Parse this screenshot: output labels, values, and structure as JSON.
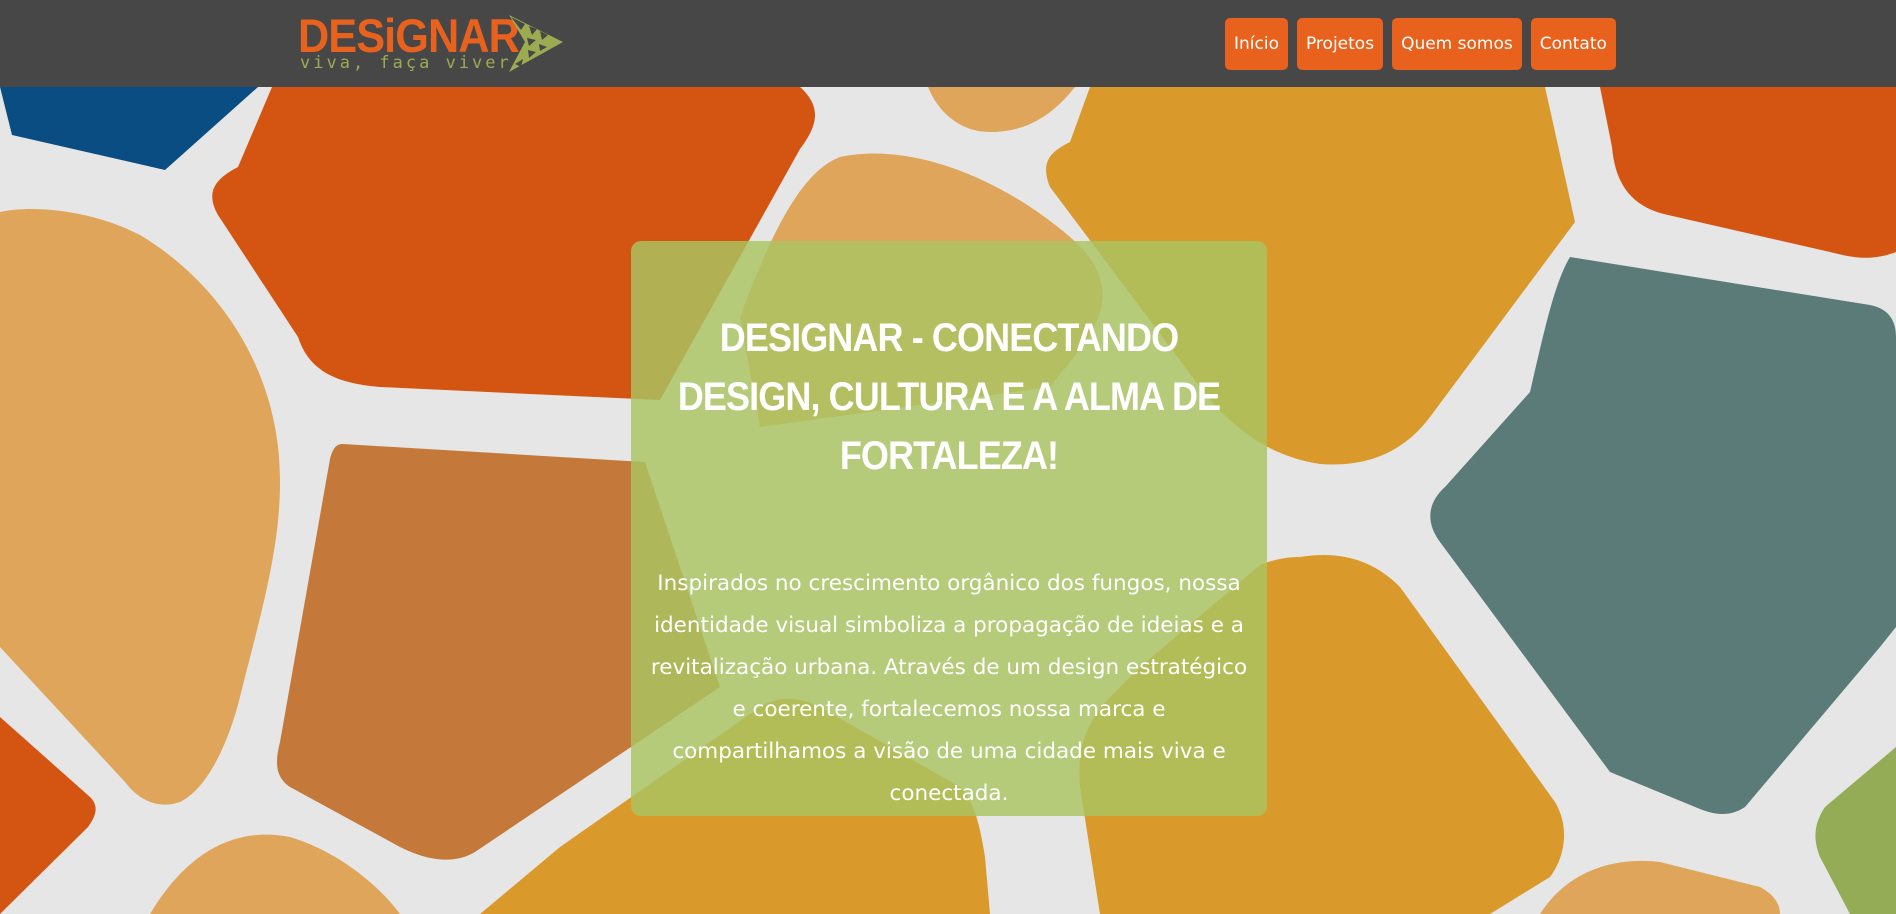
{
  "header": {
    "logo": {
      "word": "DESiGNAR",
      "tagline": "viva, faça viver",
      "icon": "arrow-mosaic-icon"
    },
    "nav": [
      {
        "label": "Início",
        "icon": null
      },
      {
        "label": "Projetos",
        "icon": null
      },
      {
        "label": "Quem somos",
        "icon": null
      },
      {
        "label": "Contato",
        "icon": null
      }
    ]
  },
  "hero": {
    "title": "Designar - Conectando Design, Cultura e a Alma de Fortaleza!",
    "text": "Inspirados no crescimento orgânico dos fungos, nossa identidade visual simboliza a propagação de ideias e a revitalização urbana. Através de um design estratégico e coerente, fortalecemos nossa marca e compartilhamos a visão de uma cidade mais viva e conectada."
  },
  "colors": {
    "header_bg": "#474747",
    "accent_orange": "#e8621d",
    "accent_green": "#a9c462",
    "background": "#e6e6e6",
    "mosaic": [
      "#0a4d82",
      "#d45511",
      "#dfa65b",
      "#c4793a",
      "#d99a2b",
      "#5b7b78",
      "#93ac55"
    ]
  }
}
